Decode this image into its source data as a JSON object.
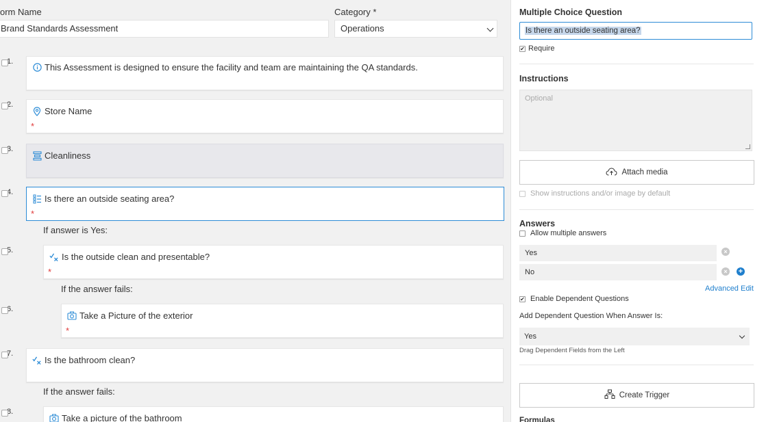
{
  "form": {
    "name_label": "orm Name",
    "name_value": "Brand Standards Assessment",
    "category_label": "Category *",
    "category_value": "Operations"
  },
  "questions": [
    {
      "num": "1.",
      "text": "This Assessment is designed to ensure the facility and team are maintaining the QA standards.",
      "icon": "info-icon"
    },
    {
      "num": "2.",
      "text": "Store Name",
      "icon": "location-pin-icon",
      "required": "*"
    },
    {
      "num": "3.",
      "text": "Cleanliness",
      "icon": "section-icon"
    },
    {
      "num": "4.",
      "text": "Is there an outside seating area?",
      "icon": "multiple-choice-icon",
      "required": "*"
    },
    {
      "num": "5.",
      "text": "Is the outside clean and presentable?",
      "icon": "pass-fail-icon",
      "required": "*"
    },
    {
      "num": "6.",
      "text": "Take a Picture of the exterior",
      "icon": "camera-icon",
      "required": "*"
    },
    {
      "num": "7.",
      "text": "Is the bathroom clean?",
      "icon": "pass-fail-icon"
    },
    {
      "num": "8.",
      "text": "Take a picture of the bathroom",
      "icon": "camera-icon"
    }
  ],
  "dependents": {
    "if_yes": "If answer is Yes:",
    "if_fails_1": "If the answer fails:",
    "if_fails_2": "If the answer fails:"
  },
  "panel": {
    "title": "Multiple Choice Question",
    "question_value": "Is there an outside seating area?",
    "require_label": "Require",
    "instructions_heading": "Instructions",
    "instructions_placeholder": "Optional",
    "attach_media_label": "Attach media",
    "show_instructions_label": "Show instructions and/or image by default",
    "answers_heading": "Answers",
    "allow_multiple_label": "Allow multiple answers",
    "answers": [
      "Yes",
      "No"
    ],
    "advanced_edit_label": "Advanced Edit",
    "enable_dependent_label": "Enable Dependent Questions",
    "add_dependent_label": "Add Dependent Question When Answer Is:",
    "dependent_answer_value": "Yes",
    "drag_hint": "Drag Dependent Fields from the Left",
    "create_trigger_label": "Create Trigger",
    "formulas_heading": "Formulas"
  },
  "colors": {
    "accent": "#2b8bd6",
    "required": "#e03a3a",
    "link": "#1f7fcd"
  }
}
